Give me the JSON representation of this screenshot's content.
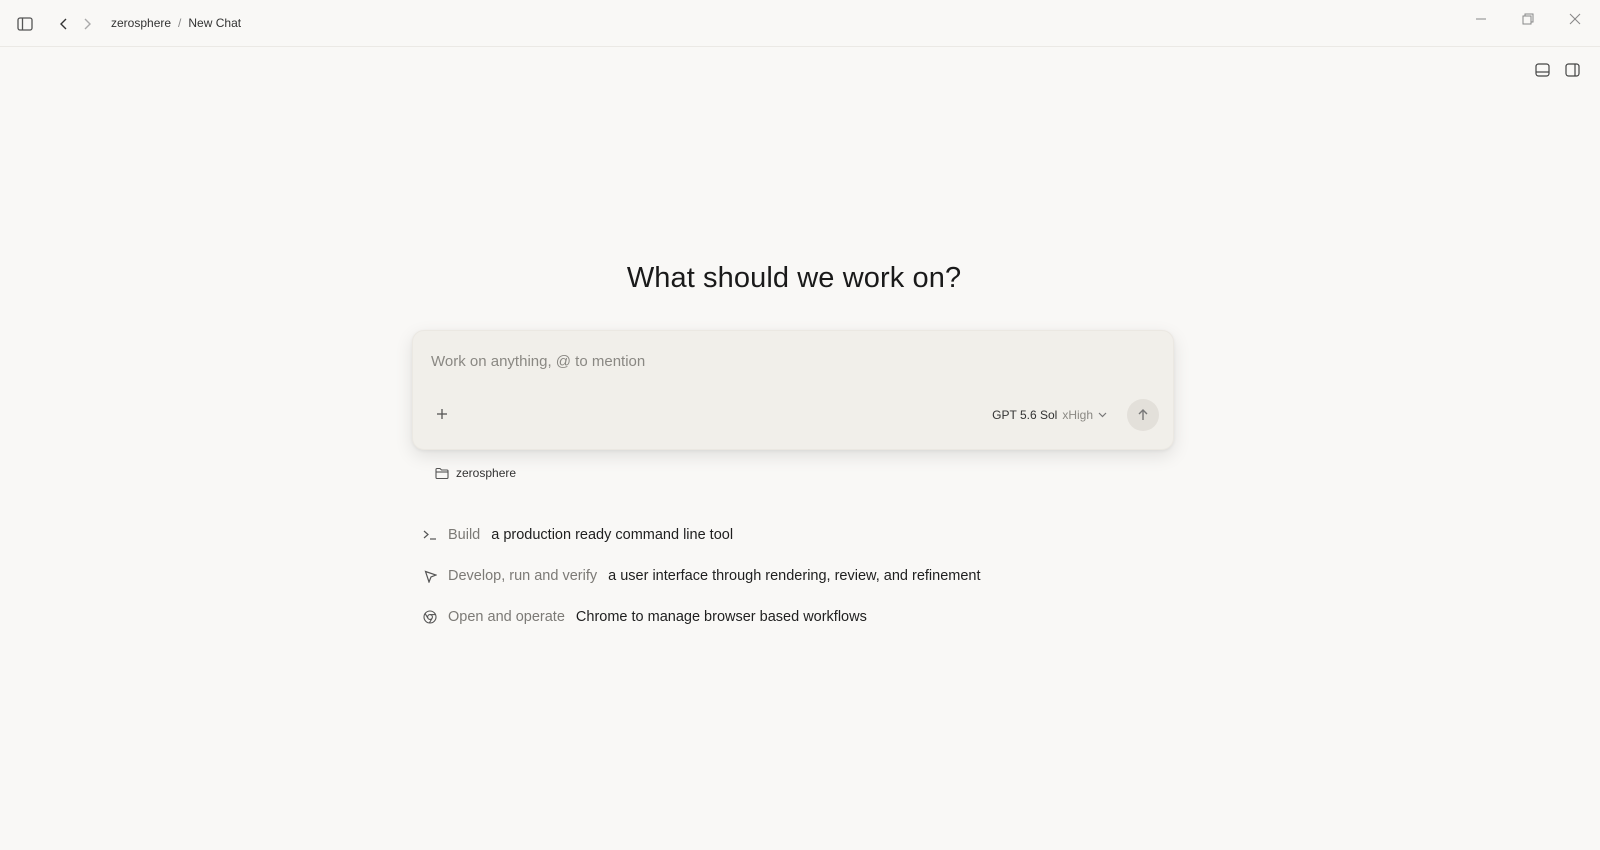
{
  "breadcrumb": {
    "workspace": "zerosphere",
    "separator": "/",
    "page": "New Chat"
  },
  "main": {
    "heading": "What should we work on?"
  },
  "composer": {
    "placeholder": "Work on anything, @ to mention",
    "value": "",
    "model": "GPT 5.6 Sol",
    "effort": "xHigh"
  },
  "folder": {
    "label": "zerosphere"
  },
  "suggestions": [
    {
      "icon": "terminal-icon",
      "verb": "Build",
      "object": "a production ready command line tool"
    },
    {
      "icon": "cursor-arrow-icon",
      "verb": "Develop, run and verify",
      "object": "a user interface through rendering, review, and refinement"
    },
    {
      "icon": "chrome-icon",
      "verb": "Open and operate",
      "object": "Chrome to manage browser based workflows"
    }
  ]
}
